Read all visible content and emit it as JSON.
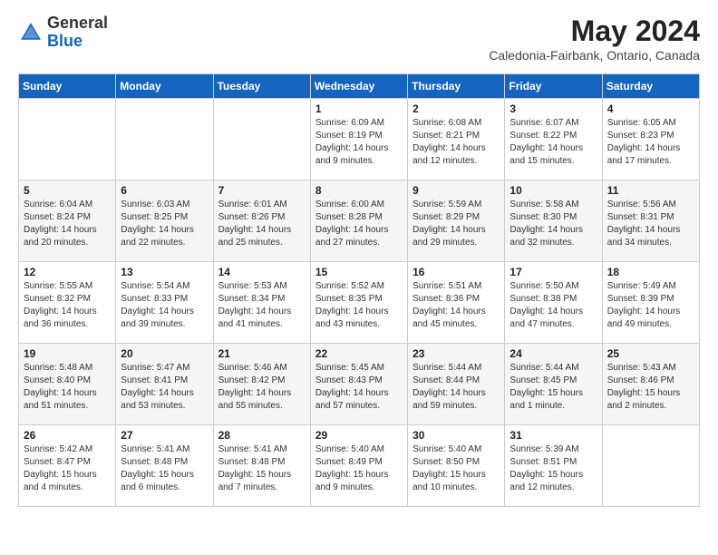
{
  "header": {
    "logo_general": "General",
    "logo_blue": "Blue",
    "month_title": "May 2024",
    "location": "Caledonia-Fairbank, Ontario, Canada"
  },
  "days_of_week": [
    "Sunday",
    "Monday",
    "Tuesday",
    "Wednesday",
    "Thursday",
    "Friday",
    "Saturday"
  ],
  "weeks": [
    [
      {
        "day": "",
        "info": ""
      },
      {
        "day": "",
        "info": ""
      },
      {
        "day": "",
        "info": ""
      },
      {
        "day": "1",
        "info": "Sunrise: 6:09 AM\nSunset: 8:19 PM\nDaylight: 14 hours\nand 9 minutes."
      },
      {
        "day": "2",
        "info": "Sunrise: 6:08 AM\nSunset: 8:21 PM\nDaylight: 14 hours\nand 12 minutes."
      },
      {
        "day": "3",
        "info": "Sunrise: 6:07 AM\nSunset: 8:22 PM\nDaylight: 14 hours\nand 15 minutes."
      },
      {
        "day": "4",
        "info": "Sunrise: 6:05 AM\nSunset: 8:23 PM\nDaylight: 14 hours\nand 17 minutes."
      }
    ],
    [
      {
        "day": "5",
        "info": "Sunrise: 6:04 AM\nSunset: 8:24 PM\nDaylight: 14 hours\nand 20 minutes."
      },
      {
        "day": "6",
        "info": "Sunrise: 6:03 AM\nSunset: 8:25 PM\nDaylight: 14 hours\nand 22 minutes."
      },
      {
        "day": "7",
        "info": "Sunrise: 6:01 AM\nSunset: 8:26 PM\nDaylight: 14 hours\nand 25 minutes."
      },
      {
        "day": "8",
        "info": "Sunrise: 6:00 AM\nSunset: 8:28 PM\nDaylight: 14 hours\nand 27 minutes."
      },
      {
        "day": "9",
        "info": "Sunrise: 5:59 AM\nSunset: 8:29 PM\nDaylight: 14 hours\nand 29 minutes."
      },
      {
        "day": "10",
        "info": "Sunrise: 5:58 AM\nSunset: 8:30 PM\nDaylight: 14 hours\nand 32 minutes."
      },
      {
        "day": "11",
        "info": "Sunrise: 5:56 AM\nSunset: 8:31 PM\nDaylight: 14 hours\nand 34 minutes."
      }
    ],
    [
      {
        "day": "12",
        "info": "Sunrise: 5:55 AM\nSunset: 8:32 PM\nDaylight: 14 hours\nand 36 minutes."
      },
      {
        "day": "13",
        "info": "Sunrise: 5:54 AM\nSunset: 8:33 PM\nDaylight: 14 hours\nand 39 minutes."
      },
      {
        "day": "14",
        "info": "Sunrise: 5:53 AM\nSunset: 8:34 PM\nDaylight: 14 hours\nand 41 minutes."
      },
      {
        "day": "15",
        "info": "Sunrise: 5:52 AM\nSunset: 8:35 PM\nDaylight: 14 hours\nand 43 minutes."
      },
      {
        "day": "16",
        "info": "Sunrise: 5:51 AM\nSunset: 8:36 PM\nDaylight: 14 hours\nand 45 minutes."
      },
      {
        "day": "17",
        "info": "Sunrise: 5:50 AM\nSunset: 8:38 PM\nDaylight: 14 hours\nand 47 minutes."
      },
      {
        "day": "18",
        "info": "Sunrise: 5:49 AM\nSunset: 8:39 PM\nDaylight: 14 hours\nand 49 minutes."
      }
    ],
    [
      {
        "day": "19",
        "info": "Sunrise: 5:48 AM\nSunset: 8:40 PM\nDaylight: 14 hours\nand 51 minutes."
      },
      {
        "day": "20",
        "info": "Sunrise: 5:47 AM\nSunset: 8:41 PM\nDaylight: 14 hours\nand 53 minutes."
      },
      {
        "day": "21",
        "info": "Sunrise: 5:46 AM\nSunset: 8:42 PM\nDaylight: 14 hours\nand 55 minutes."
      },
      {
        "day": "22",
        "info": "Sunrise: 5:45 AM\nSunset: 8:43 PM\nDaylight: 14 hours\nand 57 minutes."
      },
      {
        "day": "23",
        "info": "Sunrise: 5:44 AM\nSunset: 8:44 PM\nDaylight: 14 hours\nand 59 minutes."
      },
      {
        "day": "24",
        "info": "Sunrise: 5:44 AM\nSunset: 8:45 PM\nDaylight: 15 hours\nand 1 minute."
      },
      {
        "day": "25",
        "info": "Sunrise: 5:43 AM\nSunset: 8:46 PM\nDaylight: 15 hours\nand 2 minutes."
      }
    ],
    [
      {
        "day": "26",
        "info": "Sunrise: 5:42 AM\nSunset: 8:47 PM\nDaylight: 15 hours\nand 4 minutes."
      },
      {
        "day": "27",
        "info": "Sunrise: 5:41 AM\nSunset: 8:48 PM\nDaylight: 15 hours\nand 6 minutes."
      },
      {
        "day": "28",
        "info": "Sunrise: 5:41 AM\nSunset: 8:48 PM\nDaylight: 15 hours\nand 7 minutes."
      },
      {
        "day": "29",
        "info": "Sunrise: 5:40 AM\nSunset: 8:49 PM\nDaylight: 15 hours\nand 9 minutes."
      },
      {
        "day": "30",
        "info": "Sunrise: 5:40 AM\nSunset: 8:50 PM\nDaylight: 15 hours\nand 10 minutes."
      },
      {
        "day": "31",
        "info": "Sunrise: 5:39 AM\nSunset: 8:51 PM\nDaylight: 15 hours\nand 12 minutes."
      },
      {
        "day": "",
        "info": ""
      }
    ]
  ]
}
